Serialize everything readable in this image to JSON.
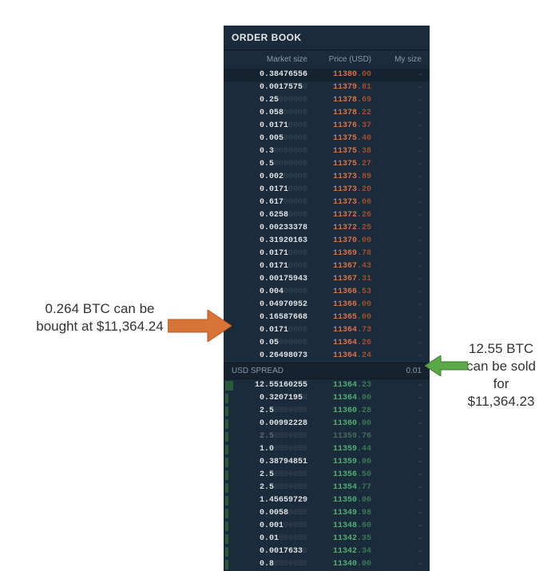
{
  "orderBook": {
    "title": "ORDER BOOK",
    "columns": {
      "size": "Market size",
      "price": "Price (USD)",
      "my": "My size"
    },
    "spread": {
      "label": "USD SPREAD",
      "value": "0.01"
    },
    "asks": [
      {
        "size": "0.38476556",
        "priceMain": "11380",
        "priceDec": ".00"
      },
      {
        "size": "0.0017575",
        "priceMain": "11379",
        "priceDec": ".81"
      },
      {
        "size": "0.25",
        "priceMain": "11378",
        "priceDec": ".69"
      },
      {
        "size": "0.058",
        "priceMain": "11378",
        "priceDec": ".22"
      },
      {
        "size": "0.0171",
        "priceMain": "11376",
        "priceDec": ".37"
      },
      {
        "size": "0.005",
        "priceMain": "11375",
        "priceDec": ".40"
      },
      {
        "size": "0.3",
        "priceMain": "11375",
        "priceDec": ".38"
      },
      {
        "size": "0.5",
        "priceMain": "11375",
        "priceDec": ".27"
      },
      {
        "size": "0.002",
        "priceMain": "11373",
        "priceDec": ".89"
      },
      {
        "size": "0.0171",
        "priceMain": "11373",
        "priceDec": ".20"
      },
      {
        "size": "0.617",
        "priceMain": "11373",
        "priceDec": ".06"
      },
      {
        "size": "0.6258",
        "priceMain": "11372",
        "priceDec": ".26"
      },
      {
        "size": "0.00233378",
        "priceMain": "11372",
        "priceDec": ".25"
      },
      {
        "size": "0.31920163",
        "priceMain": "11370",
        "priceDec": ".00"
      },
      {
        "size": "0.0171",
        "priceMain": "11369",
        "priceDec": ".78"
      },
      {
        "size": "0.0171",
        "priceMain": "11367",
        "priceDec": ".43"
      },
      {
        "size": "0.00175943",
        "priceMain": "11367",
        "priceDec": ".31"
      },
      {
        "size": "0.004",
        "priceMain": "11366",
        "priceDec": ".53"
      },
      {
        "size": "0.04970952",
        "priceMain": "11366",
        "priceDec": ".00"
      },
      {
        "size": "0.16587668",
        "priceMain": "11365",
        "priceDec": ".00"
      },
      {
        "size": "0.0171",
        "priceMain": "11364",
        "priceDec": ".73"
      },
      {
        "size": "0.05",
        "priceMain": "11364",
        "priceDec": ".26"
      },
      {
        "size": "0.26498073",
        "priceMain": "11364",
        "priceDec": ".24"
      }
    ],
    "bids": [
      {
        "size": "12.55160255",
        "priceMain": "11364",
        "priceDec": ".23",
        "bigBar": true
      },
      {
        "size": "0.3207195",
        "priceMain": "11364",
        "priceDec": ".00"
      },
      {
        "size": "2.5",
        "priceMain": "11360",
        "priceDec": ".28"
      },
      {
        "size": "0.00992228",
        "priceMain": "11360",
        "priceDec": ".00"
      },
      {
        "size": "2.5",
        "priceMain": "11359",
        "priceDec": ".76",
        "dim": true
      },
      {
        "size": "1.0",
        "priceMain": "11359",
        "priceDec": ".44"
      },
      {
        "size": "0.38794851",
        "priceMain": "11359",
        "priceDec": ".00"
      },
      {
        "size": "2.5",
        "priceMain": "11356",
        "priceDec": ".50"
      },
      {
        "size": "2.5",
        "priceMain": "11354",
        "priceDec": ".77"
      },
      {
        "size": "1.45659729",
        "priceMain": "11350",
        "priceDec": ".00"
      },
      {
        "size": "0.0058",
        "priceMain": "11349",
        "priceDec": ".98"
      },
      {
        "size": "0.001",
        "priceMain": "11348",
        "priceDec": ".60"
      },
      {
        "size": "0.01",
        "priceMain": "11342",
        "priceDec": ".35"
      },
      {
        "size": "0.0017633",
        "priceMain": "11342",
        "priceDec": ".34"
      },
      {
        "size": "0.8",
        "priceMain": "11340",
        "priceDec": ".00"
      }
    ]
  },
  "annotations": {
    "left": "0.264 BTC can be bought at $11,364.24",
    "right": "12.55 BTC can be sold for $11,364.23"
  }
}
